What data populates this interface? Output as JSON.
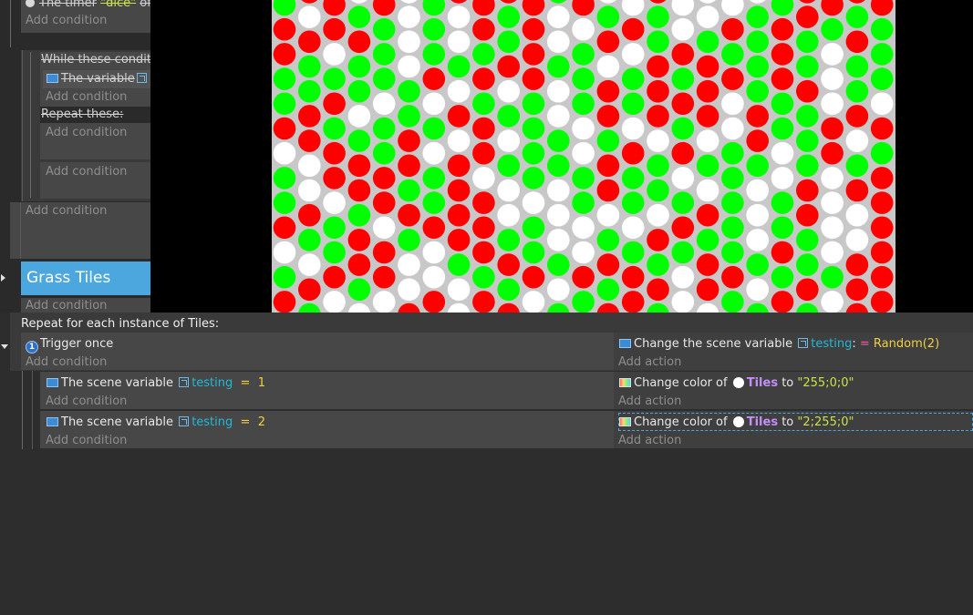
{
  "upper_events": {
    "timer_condition": {
      "prefix": "The timer",
      "name": "\"dice\"",
      "suffix": "of"
    },
    "add_condition": "Add condition",
    "while_header": "While these conditi",
    "while_condition": "The variable",
    "repeat_header": "Repeat these:",
    "group_title": "Grass Tiles"
  },
  "preview": {
    "dot_colors": [
      "#ff0000",
      "#00ff00",
      "#ffffff"
    ],
    "background": "#c8c8c8"
  },
  "events": {
    "repeat_header": "Repeat for each instance of Tiles:",
    "add_condition": "Add condition",
    "add_action": "Add action",
    "event1": {
      "condition": "Trigger once",
      "once_badge": "1",
      "action": {
        "text": "Change the scene variable",
        "variable": "testing",
        "colon": ":",
        "operator": "=",
        "value": "Random(2)"
      }
    },
    "event2": {
      "condition": {
        "text": "The scene variable",
        "variable": "testing",
        "operator": "=",
        "value": "1"
      },
      "action": {
        "text": "Change color of",
        "object": "Tiles",
        "to": "to",
        "value": "\"255;0;0\""
      }
    },
    "event3": {
      "condition": {
        "text": "The scene variable",
        "variable": "testing",
        "operator": "=",
        "value": "2"
      },
      "action": {
        "text": "Change color of",
        "object": "Tiles",
        "to": "to",
        "value": "\"2;255;0\""
      }
    }
  }
}
